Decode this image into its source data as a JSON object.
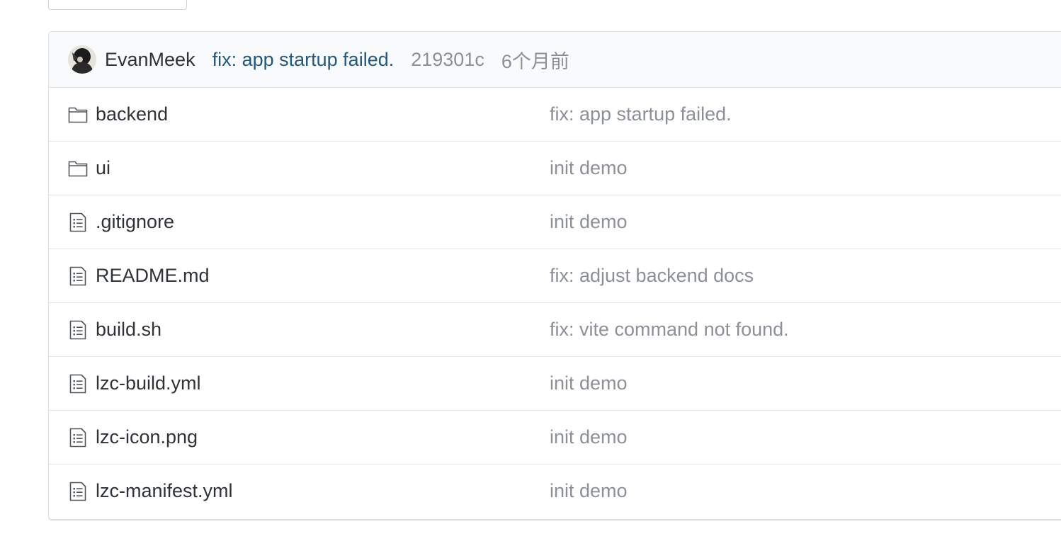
{
  "latest_commit": {
    "author": "EvanMeek",
    "message": "fix: app startup failed.",
    "sha": "219301c",
    "time_ago": "6个月前"
  },
  "files": [
    {
      "name": "backend",
      "type": "folder",
      "icon": "folder-icon",
      "commit_message": "fix: app startup failed."
    },
    {
      "name": "ui",
      "type": "folder",
      "icon": "folder-icon",
      "commit_message": "init demo"
    },
    {
      "name": ".gitignore",
      "type": "file",
      "icon": "file-text-icon",
      "commit_message": "init demo"
    },
    {
      "name": "README.md",
      "type": "file",
      "icon": "file-text-icon",
      "commit_message": "fix: adjust backend docs"
    },
    {
      "name": "build.sh",
      "type": "file",
      "icon": "file-text-icon",
      "commit_message": "fix: vite command not found."
    },
    {
      "name": "lzc-build.yml",
      "type": "file",
      "icon": "file-text-icon",
      "commit_message": "init demo"
    },
    {
      "name": "lzc-icon.png",
      "type": "file",
      "icon": "file-text-icon",
      "commit_message": "init demo"
    },
    {
      "name": "lzc-manifest.yml",
      "type": "file",
      "icon": "file-text-icon",
      "commit_message": "init demo"
    }
  ],
  "colors": {
    "link": "#215a80",
    "muted": "#8c9098",
    "header_bg": "#f9fafb",
    "border": "#dcdee2"
  }
}
